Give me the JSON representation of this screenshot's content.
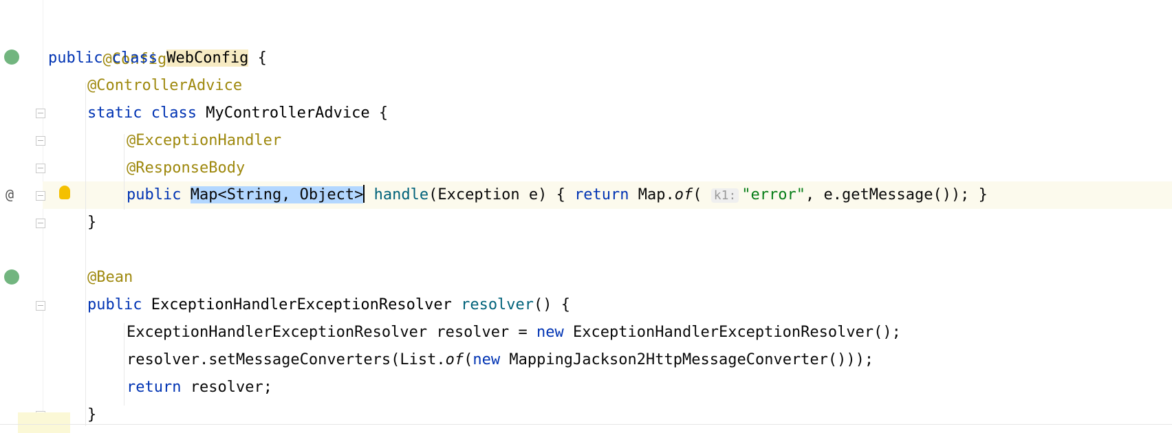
{
  "editor": {
    "gutter": {
      "at_marker": "@"
    },
    "icons": {
      "bean_gutter": "spring-bean-icon",
      "config_gutter": "spring-config-icon",
      "intention": "lightbulb-icon",
      "fold": "fold-marker-icon"
    },
    "colors": {
      "keyword": "#0033b3",
      "annotation": "#9e880d",
      "string": "#067d17",
      "method": "#00627a",
      "selection": "#b3d7ff",
      "highlight": "#f7ebc3"
    },
    "lines": {
      "l1": {
        "annotation": "@Configuration"
      },
      "l2": {
        "kw_public": "public",
        "kw_class": "class",
        "name": "WebConfig",
        "brace": " {"
      },
      "l3": {
        "annotation": "@ControllerAdvice"
      },
      "l4": {
        "kw_static": "static",
        "kw_class": "class",
        "name": "MyControllerAdvice",
        "brace": " {"
      },
      "l5": {
        "annotation": "@ExceptionHandler"
      },
      "l6": {
        "annotation": "@ResponseBody"
      },
      "l7": {
        "kw_public": "public",
        "selected": "Map<String, Object>",
        "method": "handle",
        "params": "(Exception e) { ",
        "kw_return": "return",
        "map": " Map.",
        "of": "of",
        "open": "( ",
        "hint": "k1:",
        "str": "\"error\"",
        "rest": ", e.getMessage()); }"
      },
      "l8": {
        "brace": "}"
      },
      "l9": {
        "annotation": "@Bean"
      },
      "l10": {
        "kw_public": "public",
        "type": "ExceptionHandlerExceptionResolver",
        "method": "resolver",
        "rest": "() {"
      },
      "l11": {
        "decl": "ExceptionHandlerExceptionResolver resolver = ",
        "kw_new": "new",
        "rest": " ExceptionHandlerExceptionResolver();"
      },
      "l12": {
        "start": "resolver.setMessageConverters(List.",
        "of": "of",
        "open": "(",
        "kw_new": "new",
        "rest": " MappingJackson2HttpMessageConverter()));"
      },
      "l13": {
        "kw_return": "return",
        "rest": " resolver;"
      },
      "l14": {
        "brace": "}"
      }
    }
  }
}
